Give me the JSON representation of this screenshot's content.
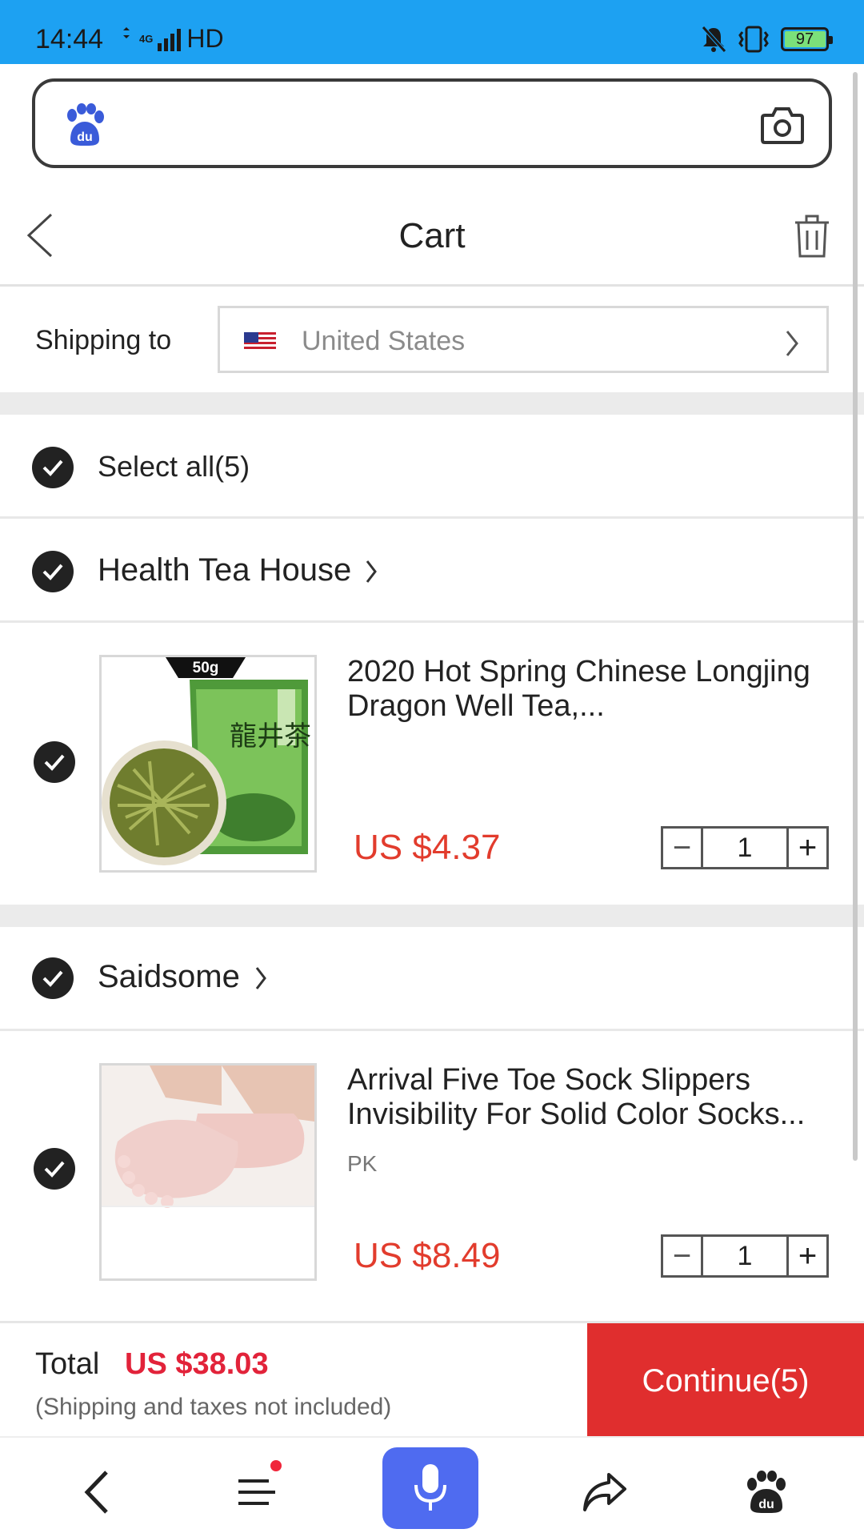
{
  "status_bar": {
    "time": "14:44",
    "network": "4G",
    "hd": "HD",
    "battery": "97"
  },
  "search": {
    "logo_icon": "baidu-paw-icon",
    "camera_icon": "camera-icon"
  },
  "header": {
    "title": "Cart",
    "back_icon": "chevron-left-icon",
    "delete_icon": "trash-icon"
  },
  "shipping": {
    "label": "Shipping to",
    "country": "United States",
    "flag_icon": "us-flag-icon"
  },
  "select_all": {
    "label": "Select all(5)",
    "checked": true
  },
  "stores": [
    {
      "name": "Health Tea House",
      "checked": true,
      "items": [
        {
          "title": "2020 Hot Spring Chinese Longjing Dragon Well Tea,...",
          "sku": "",
          "price": "US $4.37",
          "quantity": "1",
          "image_badge": "50g",
          "image_caption": "龍井茶",
          "checked": true
        }
      ]
    },
    {
      "name": "Saidsome",
      "checked": true,
      "items": [
        {
          "title": "Arrival Five Toe Sock Slippers Invisibility For Solid Color Socks...",
          "sku": "PK",
          "price": "US $8.49",
          "quantity": "1",
          "checked": true
        }
      ]
    }
  ],
  "footer": {
    "total_label": "Total",
    "total_amount": "US $38.03",
    "note": "(Shipping and taxes not included)",
    "continue_label": "Continue(5)"
  },
  "bottom_nav": {
    "items": [
      "back-icon",
      "menu-icon",
      "microphone-icon",
      "share-icon",
      "baidu-paw-icon"
    ]
  },
  "colors": {
    "status_bar": "#1da1f2",
    "price": "#e23c2d",
    "total": "#e2233a",
    "continue_button": "#e02e2e",
    "mic_button": "#4f6bf0"
  }
}
